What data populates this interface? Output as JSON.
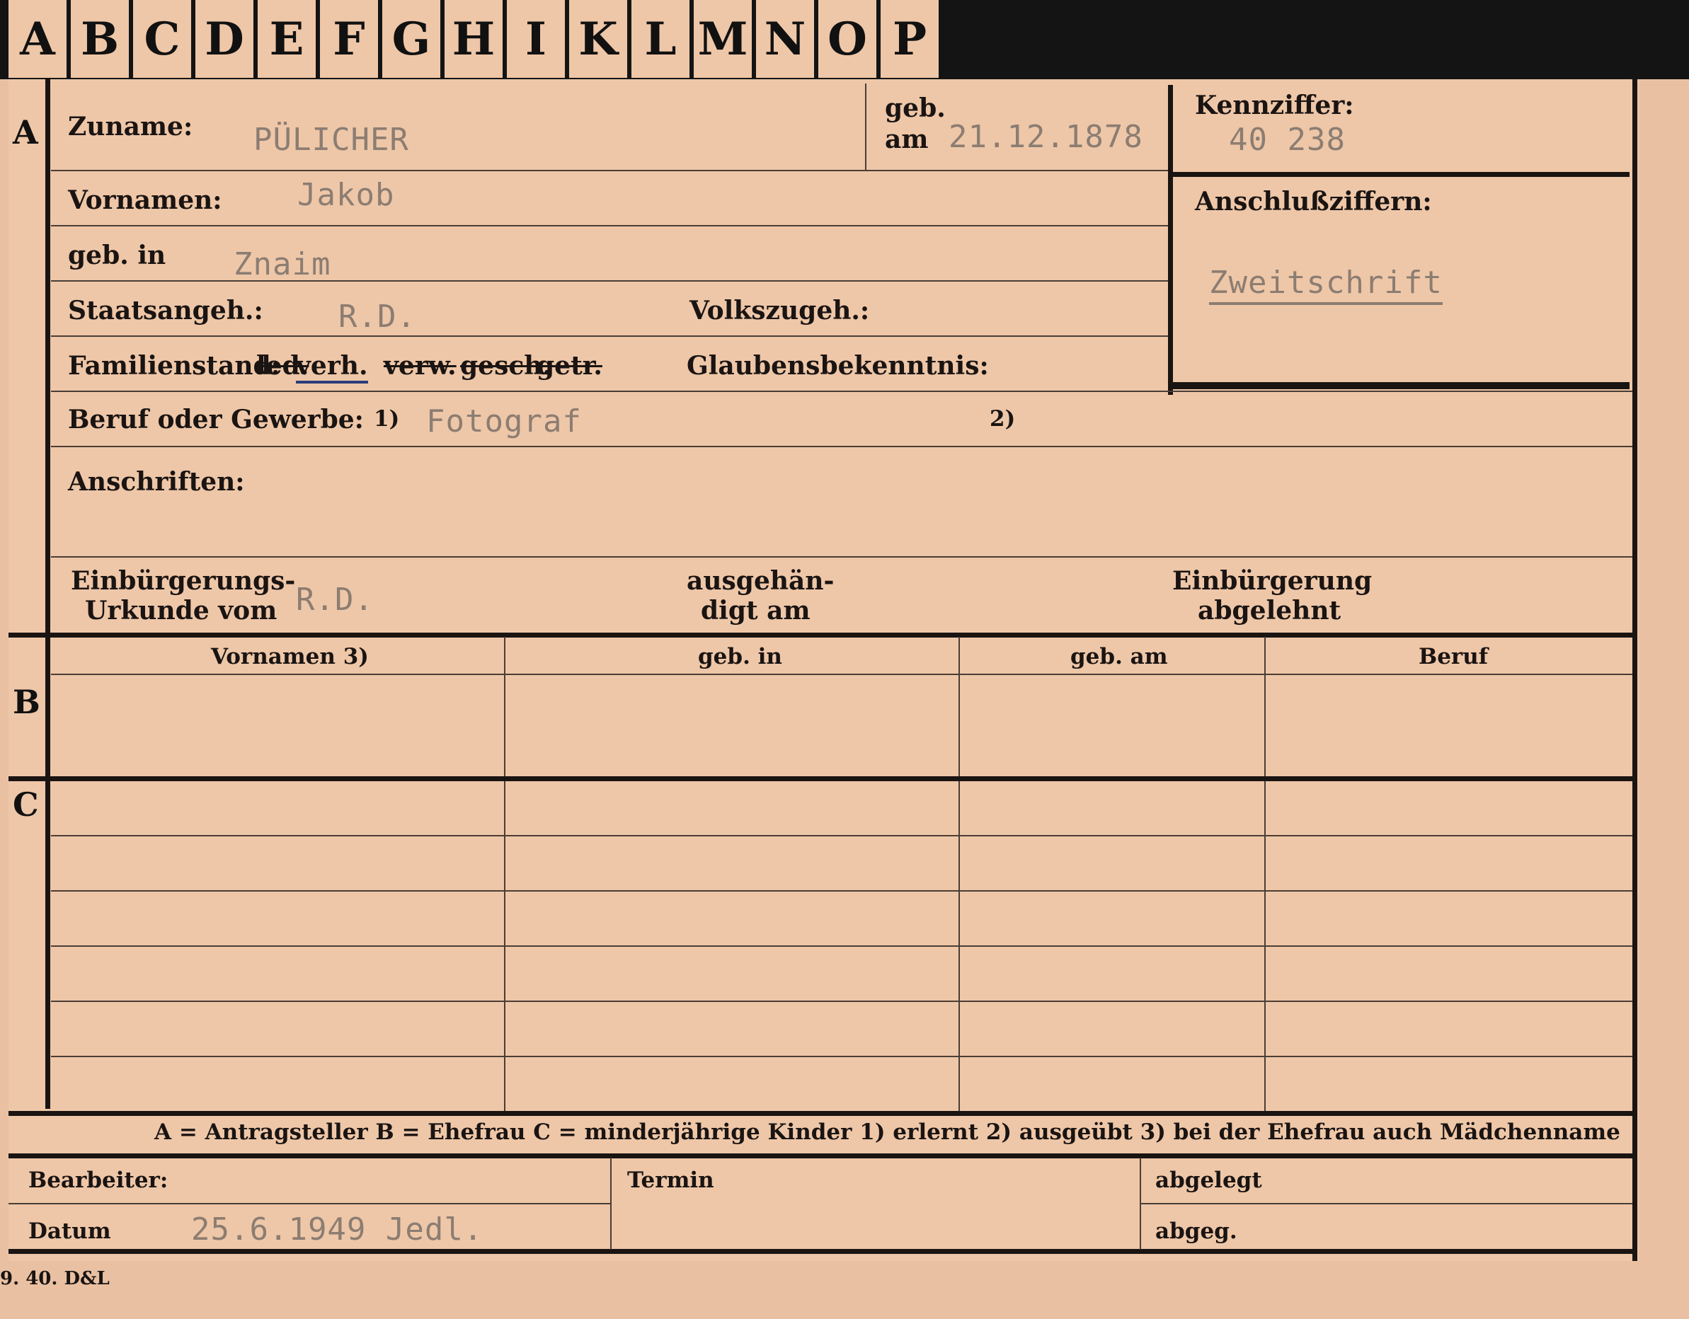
{
  "tabs": [
    "A",
    "B",
    "C",
    "D",
    "E",
    "F",
    "G",
    "H",
    "I",
    "K",
    "L",
    "M",
    "N",
    "O",
    "P"
  ],
  "sections": {
    "a": "A",
    "b": "B",
    "c": "C"
  },
  "applicant": {
    "surname_label": "Zuname:",
    "surname": "PÜLICHER",
    "born_label_1": "geb.",
    "born_label_2": "am",
    "birth_date": "21.12.1878",
    "reference_label": "Kennziffer:",
    "reference": "40 238",
    "linked_label": "Anschlußziffern:",
    "copy_note": "Zweitschrift",
    "first_names_label": "Vornamen:",
    "first_names": "Jakob",
    "birthplace_label": "geb. in",
    "birthplace": "Znaim",
    "citizenship_label": "Staatsangeh.:",
    "citizenship": "R.D.",
    "ethnicity_label": "Volkszugeh.:",
    "marital_label": "Familienstand:",
    "marital_options": [
      "led.",
      "verh.",
      "verw.",
      "gesch.",
      "getr."
    ],
    "religion_label": "Glaubensbekenntnis:",
    "occupation_label": "Beruf oder Gewerbe:",
    "occupation_note_1": "1)",
    "occupation": "Fotograf",
    "occupation_note_2": "2)",
    "addresses_label": "Anschriften:",
    "naturalization_label_1": "Einbürgerungs-",
    "naturalization_label_2": "Urkunde vom",
    "naturalization": "R.D.",
    "handed_label_1": "ausgehän-",
    "handed_label_2": "digt am",
    "rejected_label_1": "Einbürgerung",
    "rejected_label_2": "abgelehnt"
  },
  "family_table": {
    "headers": [
      "Vornamen 3)",
      "geb. in",
      "geb. am",
      "Beruf"
    ]
  },
  "legend": "A = Antragsteller   B = Ehefrau   C = minderjährige Kinder   1) erlernt   2) ausgeübt   3) bei der Ehefrau auch Mädchenname",
  "footer": {
    "clerk_label": "Bearbeiter:",
    "date_label": "Datum",
    "date_value": "25.6.1949 Jedl.",
    "deadline_label": "Termin",
    "filed_label": "abgelegt",
    "sent_label": "abgeg."
  },
  "imprint": "9. 40. D&L"
}
